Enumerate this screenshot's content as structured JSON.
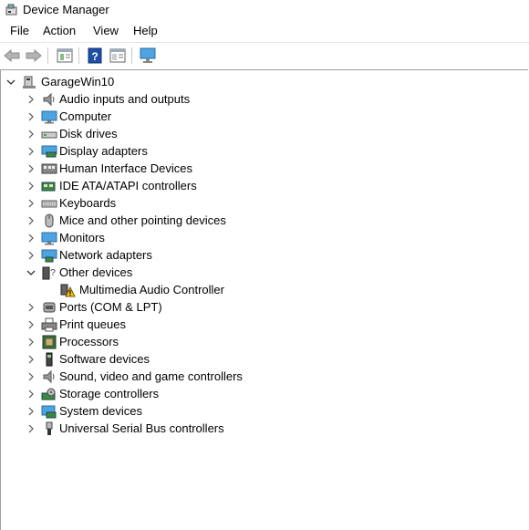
{
  "window": {
    "title": "Device Manager"
  },
  "menu": [
    "File",
    "Action",
    "View",
    "Help"
  ],
  "toolbar": {
    "buttons": [
      "back",
      "forward",
      "properties",
      "help",
      "view-hidden",
      "scan-hardware"
    ]
  },
  "tree": {
    "root": "GarageWin10",
    "categories": [
      {
        "label": "Audio inputs and outputs",
        "icon": "speaker-icon"
      },
      {
        "label": "Computer",
        "icon": "monitor-icon"
      },
      {
        "label": "Disk drives",
        "icon": "disk-drive-icon"
      },
      {
        "label": "Display adapters",
        "icon": "display-adapter-icon"
      },
      {
        "label": "Human Interface Devices",
        "icon": "hid-icon"
      },
      {
        "label": "IDE ATA/ATAPI controllers",
        "icon": "ide-controller-icon"
      },
      {
        "label": "Keyboards",
        "icon": "keyboard-icon"
      },
      {
        "label": "Mice and other pointing devices",
        "icon": "mouse-icon"
      },
      {
        "label": "Monitors",
        "icon": "monitor-icon"
      },
      {
        "label": "Network adapters",
        "icon": "network-adapter-icon"
      },
      {
        "label": "Other devices",
        "icon": "other-devices-icon",
        "expanded": true,
        "children": [
          {
            "label": "Multimedia Audio Controller",
            "icon": "warning-device-icon"
          }
        ]
      },
      {
        "label": "Ports (COM & LPT)",
        "icon": "port-icon"
      },
      {
        "label": "Print queues",
        "icon": "printer-icon"
      },
      {
        "label": "Processors",
        "icon": "processor-icon"
      },
      {
        "label": "Software devices",
        "icon": "software-device-icon"
      },
      {
        "label": "Sound, video and game controllers",
        "icon": "sound-controller-icon"
      },
      {
        "label": "Storage controllers",
        "icon": "storage-controller-icon"
      },
      {
        "label": "System devices",
        "icon": "system-devices-icon"
      },
      {
        "label": "Universal Serial Bus controllers",
        "icon": "usb-icon"
      }
    ]
  }
}
